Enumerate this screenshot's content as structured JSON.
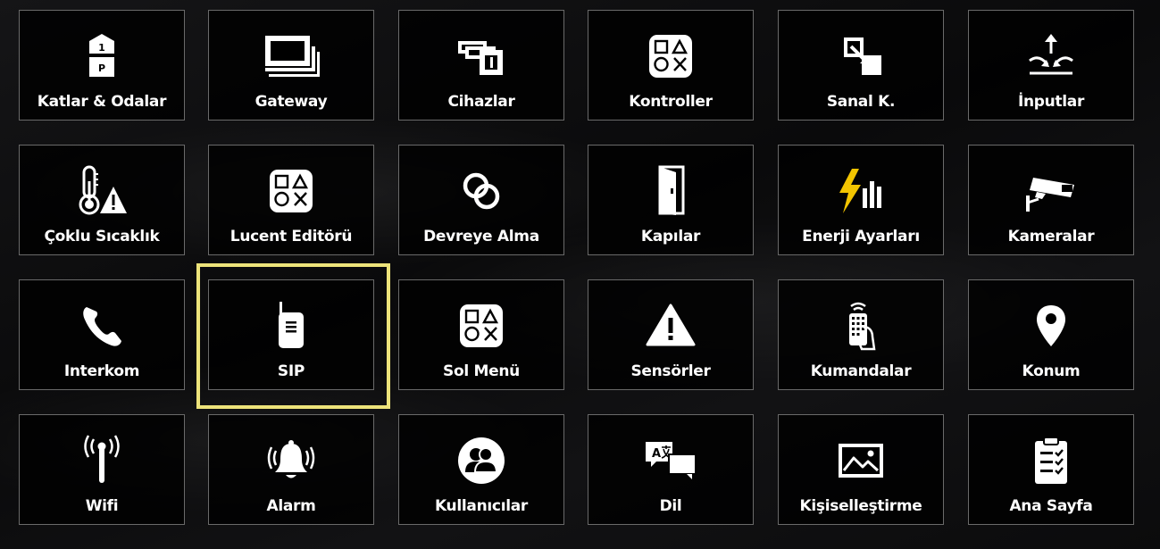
{
  "tiles": [
    {
      "label": "Katlar & Odalar",
      "icon": "floors-rooms-icon"
    },
    {
      "label": "Gateway",
      "icon": "gateway-icon"
    },
    {
      "label": "Cihazlar",
      "icon": "devices-icon"
    },
    {
      "label": "Kontroller",
      "icon": "shapes-control-icon"
    },
    {
      "label": "Sanal K.",
      "icon": "virtual-key-icon"
    },
    {
      "label": "İnputlar",
      "icon": "inputs-icon"
    },
    {
      "label": "Çoklu Sıcaklık",
      "icon": "thermometer-warning-icon"
    },
    {
      "label": "Lucent Editörü",
      "icon": "shapes-editor-icon"
    },
    {
      "label": "Devreye Alma",
      "icon": "linked-rings-icon"
    },
    {
      "label": "Kapılar",
      "icon": "door-icon"
    },
    {
      "label": "Enerji Ayarları",
      "icon": "energy-bolt-icon"
    },
    {
      "label": "Kameralar",
      "icon": "security-camera-icon"
    },
    {
      "label": "Interkom",
      "icon": "phone-icon"
    },
    {
      "label": "SIP",
      "icon": "walkie-talkie-icon"
    },
    {
      "label": "Sol Menü",
      "icon": "shapes-menu-icon"
    },
    {
      "label": "Sensörler",
      "icon": "warning-triangle-icon"
    },
    {
      "label": "Kumandalar",
      "icon": "remote-control-icon"
    },
    {
      "label": "Konum",
      "icon": "location-pin-icon"
    },
    {
      "label": "Wifi",
      "icon": "wifi-antenna-icon"
    },
    {
      "label": "Alarm",
      "icon": "alarm-bell-icon"
    },
    {
      "label": "Kullanıcılar",
      "icon": "users-icon"
    },
    {
      "label": "Dil",
      "icon": "language-icon"
    },
    {
      "label": "Kişiselleştirme",
      "icon": "image-icon"
    },
    {
      "label": "Ana Sayfa",
      "icon": "clipboard-checklist-icon"
    }
  ],
  "selected_tile": "SIP",
  "colors": {
    "tile_border": "#6a6a6a",
    "highlight": "#ede37a",
    "energy_bolt": "#f2c400",
    "text": "#ffffff"
  }
}
